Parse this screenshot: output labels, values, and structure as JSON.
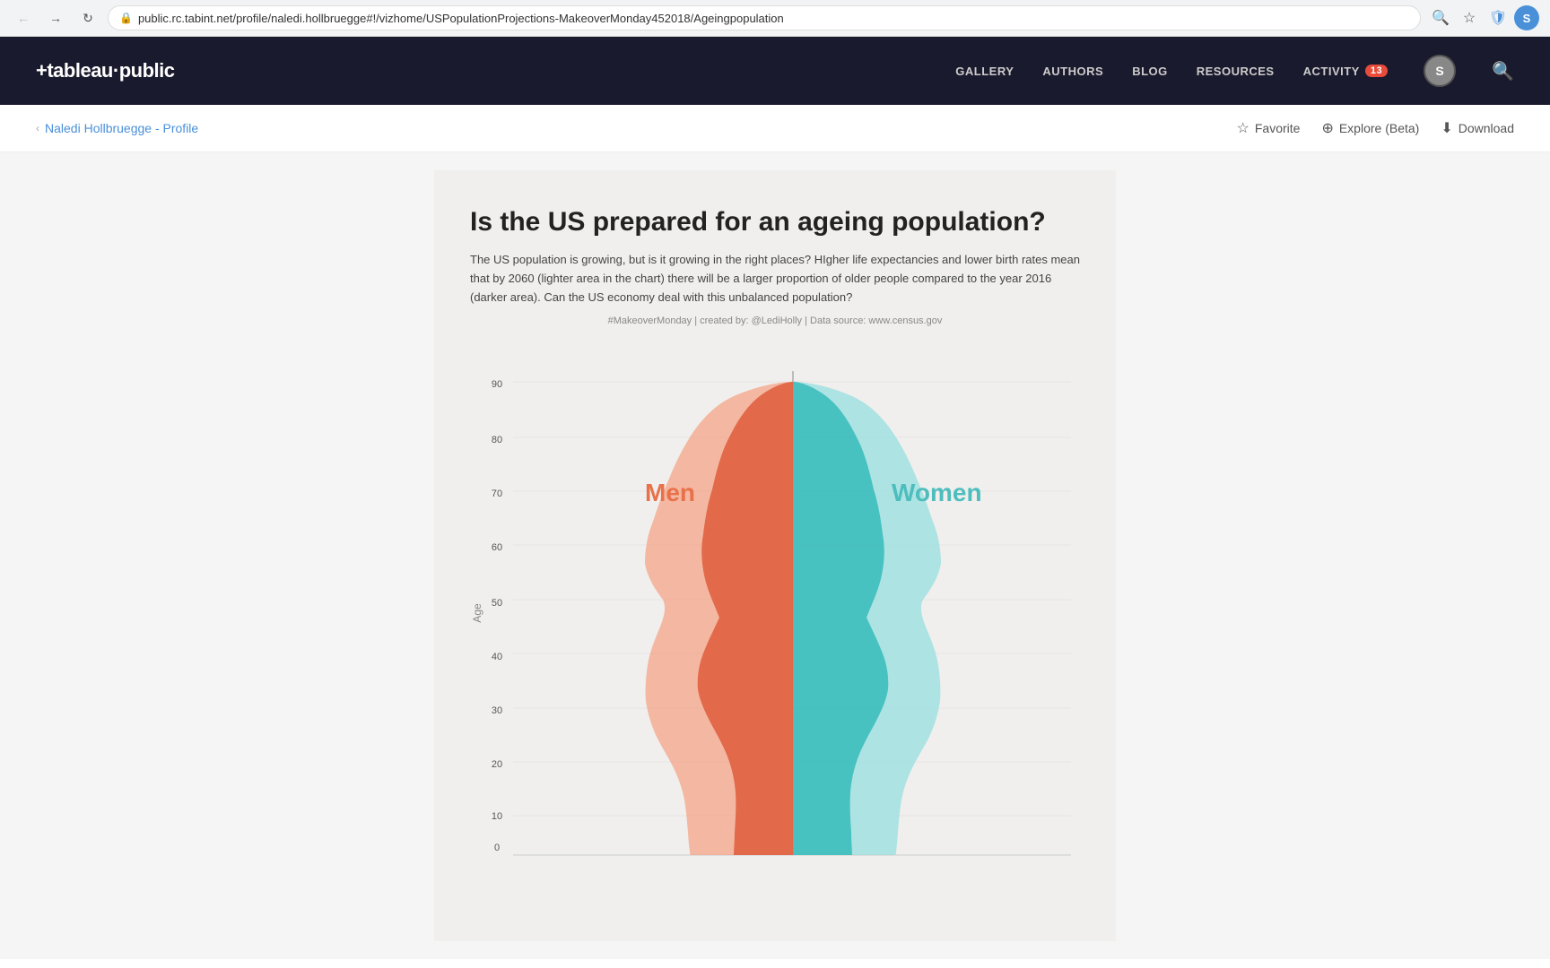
{
  "browser": {
    "url": "public.rc.tabint.net/profile/naledi.hollbruegge#!/vizhome/USPopulationProjections-MakeoverMonday452018/Ageingpopulation",
    "back_disabled": true,
    "forward_disabled": false
  },
  "header": {
    "logo": "+tableau·public",
    "nav": {
      "gallery": "GALLERY",
      "authors": "AUTHORS",
      "blog": "BLOG",
      "resources": "RESOURCES",
      "activity": "ACTIVITY",
      "activity_badge": "13"
    }
  },
  "subheader": {
    "breadcrumb_back": "‹",
    "breadcrumb_link": "Naledi Hollbruegge - Profile",
    "favorite": "Favorite",
    "explore": "Explore (Beta)",
    "download": "Download"
  },
  "viz": {
    "title": "Is the US prepared for an ageing population?",
    "description": "The US population is growing, but is it growing in the right places? HIgher life expectancies and lower birth rates mean that by 2060 (lighter area in the chart) there will be a larger proportion of older people compared to the year 2016 (darker area). Can the US economy deal with this unbalanced population?",
    "credit": "#MakeoverMonday | created by: @LediHolly | Data source: www.census.gov",
    "men_label": "Men",
    "women_label": "Women",
    "age_axis_label": "Age",
    "age_ticks": [
      "90",
      "80",
      "70",
      "60",
      "50",
      "40",
      "30",
      "20",
      "10",
      "0"
    ],
    "colors": {
      "men_dark": "#e06040",
      "men_light": "#f5a080",
      "women_dark": "#3dbdbd",
      "women_light": "#90dede"
    }
  }
}
